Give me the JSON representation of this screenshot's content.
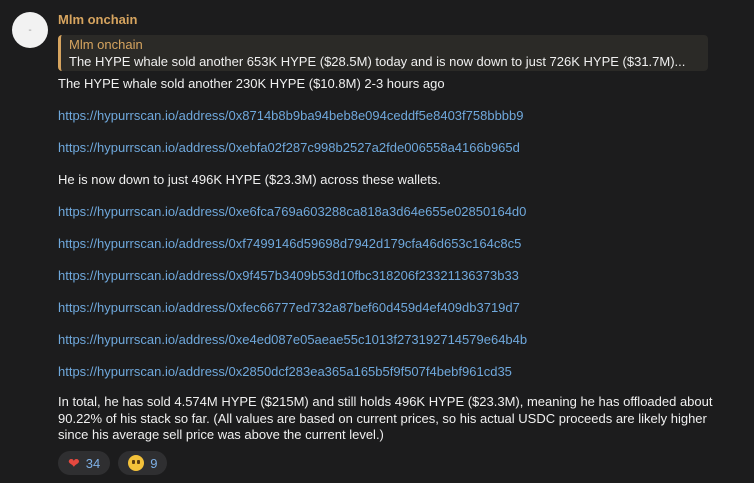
{
  "avatar": {
    "text": "-"
  },
  "message": {
    "sender": "Mlm onchain",
    "reply": {
      "name": "Mlm onchain",
      "text": "The HYPE whale sold another 653K HYPE ($28.5M) today and is now down to just 726K HYPE ($31.7M)..."
    },
    "intro": "The HYPE whale sold another 230K HYPE ($10.8M) 2-3 hours ago",
    "links_group1": [
      "https://hypurrscan.io/address/0x8714b8b9ba94beb8e094ceddf5e8403f758bbbb9",
      "https://hypurrscan.io/address/0xebfa02f287c998b2527a2fde006558a4166b965d"
    ],
    "status": " He is now down to just 496K HYPE ($23.3M) across these wallets.",
    "links_group2": [
      "https://hypurrscan.io/address/0xe6fca769a603288ca818a3d64e655e02850164d0",
      "https://hypurrscan.io/address/0xf7499146d59698d7942d179cfa46d653c164c8c5",
      "https://hypurrscan.io/address/0x9f457b3409b53d10fbc318206f23321136373b33",
      "https://hypurrscan.io/address/0xfec66777ed732a87bef60d459d4ef409db3719d7",
      "https://hypurrscan.io/address/0xe4ed087e05aeae55c1013f273192714579e64b4b",
      "https://hypurrscan.io/address/0x2850dcf283ea365a165b5f9f507f4bebf961cd35"
    ],
    "summary": "In total, he has sold 4.574M HYPE ($215M) and still holds 496K HYPE ($23.3M), meaning he has offloaded about 90.22% of his stack so far. (All values are based on current prices, so his actual USDC proceeds are likely higher since his average sell price was above the current level.)",
    "reactions": [
      {
        "icon": "heart-icon",
        "count": "34"
      },
      {
        "icon": "crying-face-icon",
        "count": "9"
      }
    ]
  },
  "colors": {
    "background": "#1c1c1d",
    "sender": "#d6a45f",
    "link": "#6fa8dc",
    "reaction_count": "#7eb0e6"
  }
}
